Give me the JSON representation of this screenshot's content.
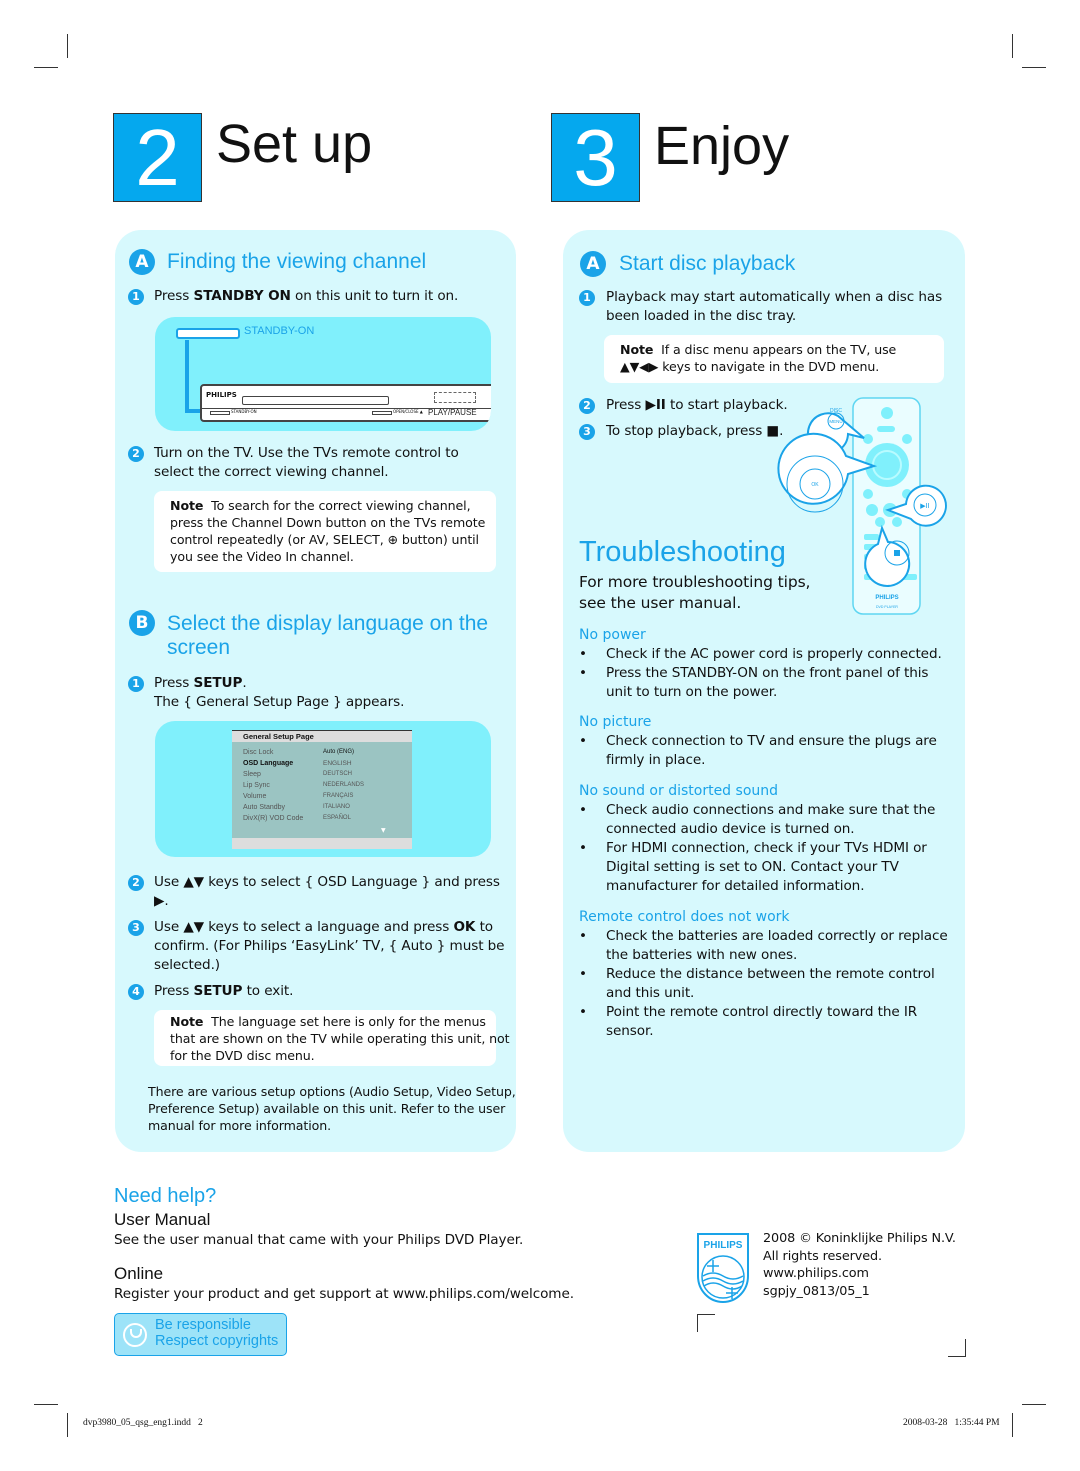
{
  "setup_header": {
    "number": "2",
    "title": "Set up"
  },
  "enjoy_header": {
    "number": "3",
    "title": "Enjoy"
  },
  "colors": {
    "accent": "#1aa3e8",
    "panel": "#d7f9fd",
    "illustration": "#80f0fc",
    "header_box": "#05a8ee"
  },
  "setup": {
    "section_a": {
      "badge": "A",
      "title": "Finding the viewing channel",
      "step1": {
        "num": "1",
        "pre": "Press ",
        "bold": "STANDBY ON",
        "post": " on this unit to turn it on."
      },
      "illustration": {
        "button_label": "STANDBY-ON",
        "brand": "PHILIPS",
        "small_labels": [
          "STANDBY-ON",
          "OPEN/CLOSE ▲",
          "PLAY/PAUSE"
        ]
      },
      "step2": {
        "num": "2",
        "lines": [
          "Turn on the TV. Use the TVs remote control to",
          "select the correct viewing channel."
        ]
      },
      "note": {
        "label": "Note",
        "lines": [
          "To search for the correct viewing channel,",
          "press the Channel Down button on the TVs remote",
          "control repeatedly (or AV, SELECT, ⊕ button) until",
          "you see the Video In channel."
        ]
      }
    },
    "section_b": {
      "badge": "B",
      "title_lines": [
        "Select the display language on the",
        "screen"
      ],
      "step1": {
        "num": "1",
        "pre": "Press ",
        "bold": "SETUP",
        "post": ".",
        "line2": "The { General Setup Page } appears."
      },
      "setup_page": {
        "title": "General Setup Page",
        "items": [
          "Disc Lock",
          "OSD Language",
          "Sleep",
          "Lip Sync",
          "Volume",
          "Auto Standby",
          "DivX(R)  VOD  Code"
        ],
        "values": [
          "Auto (ENG)",
          "ENGLISH",
          "DEUTSCH",
          "NEDERLANDS",
          "FRANÇAIS",
          "ITALIANO",
          "ESPAÑOL"
        ],
        "selected": "OSD Language"
      },
      "step2": {
        "num": "2",
        "line1": "Use ▲▼ keys to select { OSD Language } and press",
        "line2": "▶."
      },
      "step3": {
        "num": "3",
        "pre": "Use ▲▼ keys to select a language and press ",
        "bold": "OK",
        "post": " to",
        "lines": [
          "confirm. (For Philips ‘EasyLink’ TV, { Auto } must be",
          "selected.)"
        ]
      },
      "step4": {
        "num": "4",
        "pre": "Press ",
        "bold": "SETUP",
        "post": " to exit."
      },
      "note": {
        "label": "Note",
        "lines": [
          "The language set here is only for the menus",
          "that are shown on the TV while operating this unit, not",
          "for the DVD disc menu."
        ]
      },
      "footer_lines": [
        "There are various setup options (Audio Setup, Video Setup,",
        "Preference Setup) available on this unit. Refer to the user",
        "manual for more information."
      ]
    }
  },
  "enjoy": {
    "section_a": {
      "badge": "A",
      "title": "Start disc playback",
      "step1": {
        "num": "1",
        "lines": [
          "Playback may start automatically when a disc has",
          "been loaded in the disc tray."
        ]
      },
      "note": {
        "label": "Note",
        "line1": "If a disc menu appears on the TV, use",
        "line2": "▲▼◀▶ keys to navigate in the DVD menu."
      },
      "step2": {
        "num": "2",
        "pre": "Press ",
        "bold": "▶II",
        "post": " to start playback."
      },
      "step3": {
        "num": "3",
        "pre": "To stop playback, press ",
        "bold": "■",
        "post": "."
      },
      "remote": {
        "disc_label": "DISC",
        "menu_label": "MENU",
        "ok_label": "OK",
        "brand": "PHILIPS",
        "model": "DVD PLAYER"
      }
    },
    "troubleshooting": {
      "title": "Troubleshooting",
      "intro": [
        "For more troubleshooting tips,",
        "see the user manual."
      ],
      "sections": [
        {
          "heading": "No power",
          "bullets": [
            [
              "Check if the AC power cord is properly connected."
            ],
            [
              "Press the STANDBY-ON on the front panel of this",
              "unit to turn on the power."
            ]
          ]
        },
        {
          "heading": "No picture",
          "bullets": [
            [
              "Check connection to TV and ensure the plugs are",
              "firmly in place."
            ]
          ]
        },
        {
          "heading": "No sound or distorted sound",
          "bullets": [
            [
              "Check audio connections and make sure that the",
              "connected audio device is turned on."
            ],
            [
              "For HDMI connection, check if your TVs HDMI or",
              "Digital setting is set to ON. Contact your TV",
              "manufacturer for detailed information."
            ]
          ]
        },
        {
          "heading": "Remote control does not work",
          "bullets": [
            [
              "Check the batteries are loaded correctly or replace",
              "the batteries with new ones."
            ],
            [
              "Reduce the distance between the remote control",
              "and this unit."
            ],
            [
              "Point the remote control directly toward the IR",
              "sensor."
            ]
          ]
        }
      ]
    }
  },
  "help": {
    "title": "Need help?",
    "manual_heading": "User Manual",
    "manual_text": "See the user manual that came with your Philips DVD Player.",
    "online_heading": "Online",
    "online_text": "Register your product and get support at www.philips.com/welcome.",
    "badge_lines": [
      "Be responsible",
      "Respect copyrights"
    ]
  },
  "legal": {
    "logo": "PHILIPS",
    "lines": [
      "2008 © Koninklijke Philips N.V.",
      "All rights reserved.",
      "www.philips.com",
      "sgpjy_0813/05_1"
    ]
  },
  "print_footer": {
    "file": "dvp3980_05_qsg_eng1.indd   2",
    "timestamp": "2008-03-28   1:35:44 PM"
  }
}
